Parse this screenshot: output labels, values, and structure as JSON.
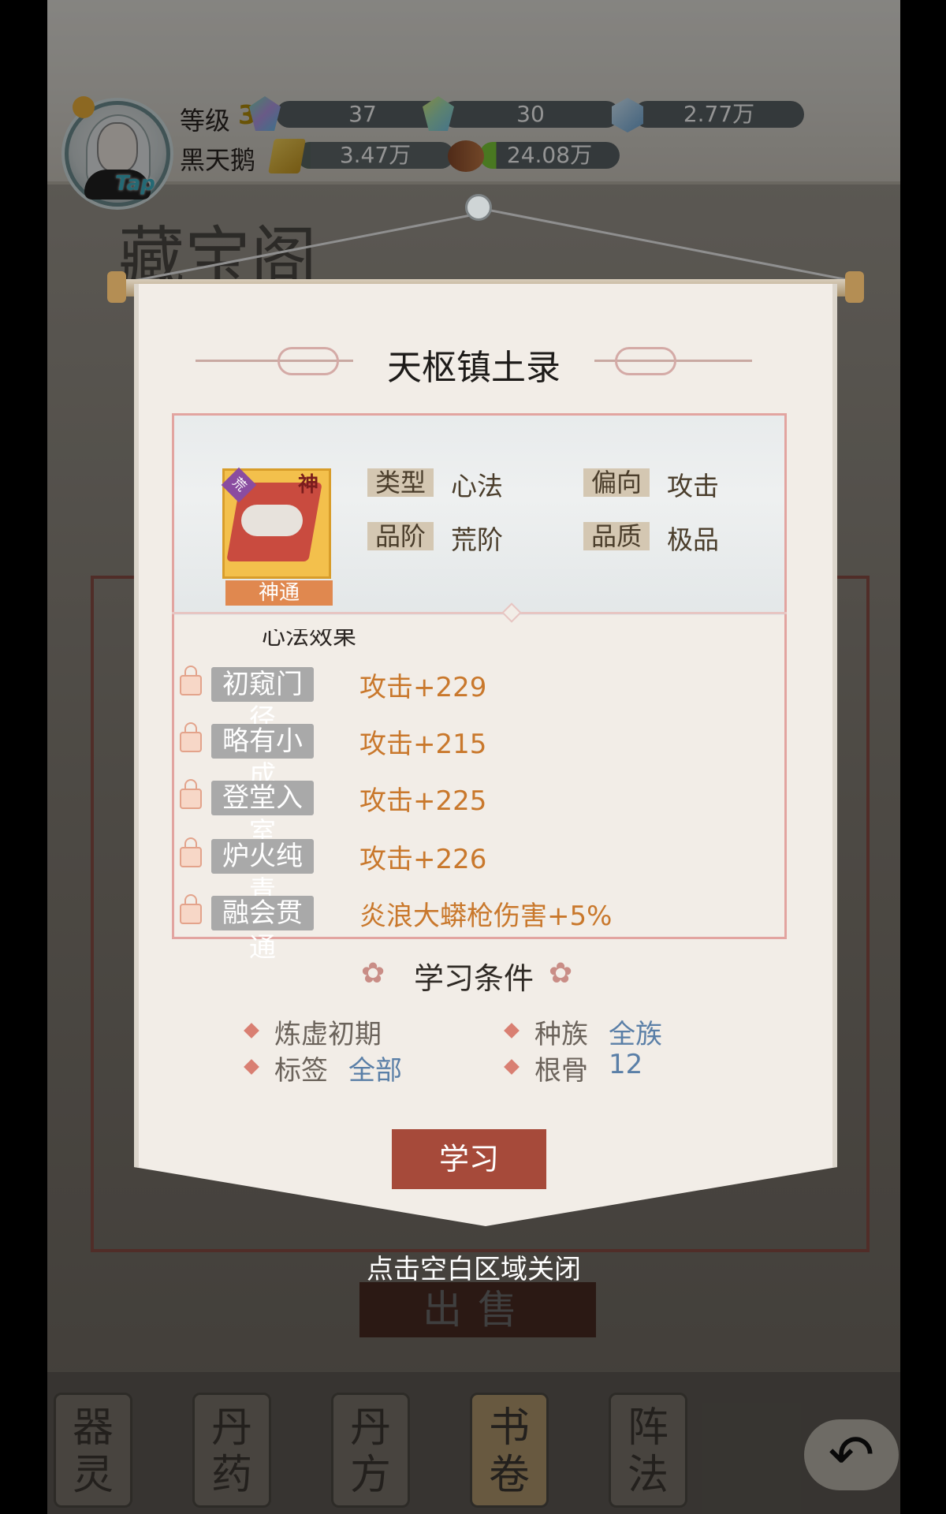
{
  "header": {
    "level_label": "等级",
    "level_value": "34",
    "username": "黑天鹅",
    "avatar_tap": "Tap",
    "resources": {
      "gem_green": "37",
      "gem_locked": "30",
      "crystal": "2.77万",
      "gold": "3.47万",
      "wood": "24.08万"
    }
  },
  "background": {
    "shop_title": "藏宝阁",
    "sell_button": "出售",
    "nav": [
      "器灵",
      "丹药",
      "丹方",
      "书卷",
      "阵法"
    ],
    "active_nav_index": 3,
    "back_icon": "↶"
  },
  "dialog": {
    "title": "天枢镇土录",
    "item": {
      "rarity_badge": "荒",
      "god_badge": "神",
      "tag": "神通"
    },
    "attributes": {
      "type_label": "类型",
      "type_value": "心法",
      "bias_label": "偏向",
      "bias_value": "攻击",
      "tier_label": "品阶",
      "tier_value": "荒阶",
      "quality_label": "品质",
      "quality_value": "极品"
    },
    "effects_header": "心法效果",
    "effects": [
      {
        "stage": "初窥门径",
        "value": "攻击+229"
      },
      {
        "stage": "略有小成",
        "value": "攻击+215"
      },
      {
        "stage": "登堂入室",
        "value": "攻击+225"
      },
      {
        "stage": "炉火纯青",
        "value": "攻击+226"
      },
      {
        "stage": "融会贯通",
        "value": "炎浪大蟒枪伤害+5%"
      }
    ],
    "conditions_title": "学习条件",
    "conditions": {
      "realm": "炼虚初期",
      "race_label": "种族",
      "race_value": "全族",
      "tag_label": "标签",
      "tag_value": "全部",
      "bone_label": "根骨",
      "bone_value": "12"
    },
    "learn_button": "学习",
    "close_hint": "点击空白区域关闭"
  }
}
